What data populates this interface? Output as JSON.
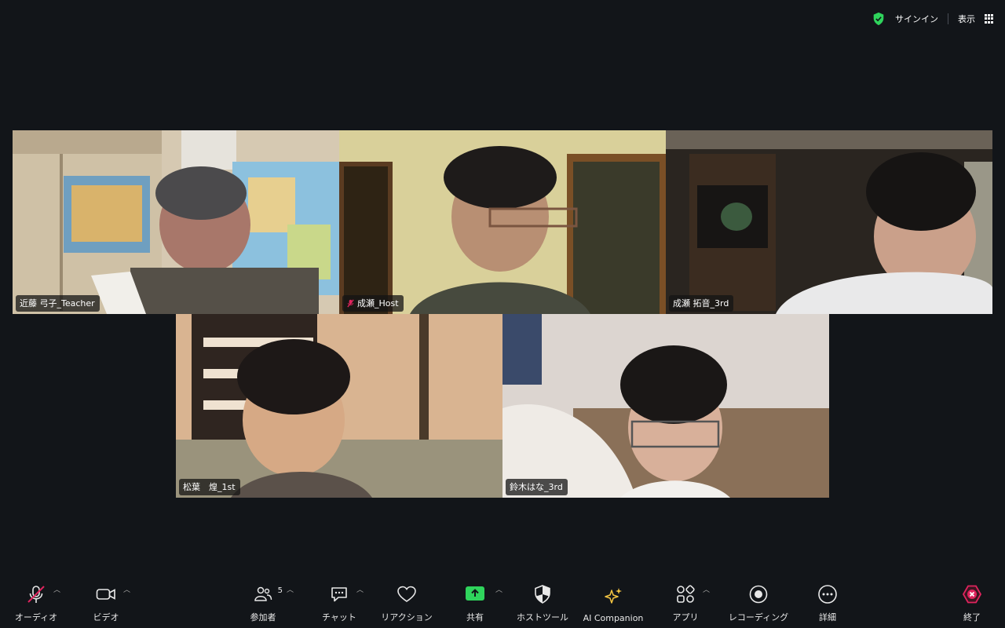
{
  "topbar": {
    "sign_in_label": "サインイン",
    "view_label": "表示",
    "shield_color": "#2fd45c"
  },
  "participants": [
    {
      "name": "近藤 弓子_Teacher",
      "muted": false,
      "active_speaker": true
    },
    {
      "name": "成瀬_Host",
      "muted": true,
      "active_speaker": false
    },
    {
      "name": "成瀬 拓音_3rd",
      "muted": false,
      "active_speaker": false
    },
    {
      "name": "松葉　煌_1st",
      "muted": false,
      "active_speaker": false
    },
    {
      "name": "鈴木はな_3rd",
      "muted": false,
      "active_speaker": false
    }
  ],
  "toolbar": {
    "audio_label": "オーディオ",
    "video_label": "ビデオ",
    "participants_label": "参加者",
    "participants_count": "5",
    "chat_label": "チャット",
    "reactions_label": "リアクション",
    "share_label": "共有",
    "host_tools_label": "ホストツール",
    "ai_companion_label": "AI Companion",
    "apps_label": "アプリ",
    "recording_label": "レコーディング",
    "more_label": "詳細",
    "end_label": "終了",
    "share_color": "#2fd45c",
    "end_color": "#e0245e",
    "mute_color": "#e0245e"
  }
}
